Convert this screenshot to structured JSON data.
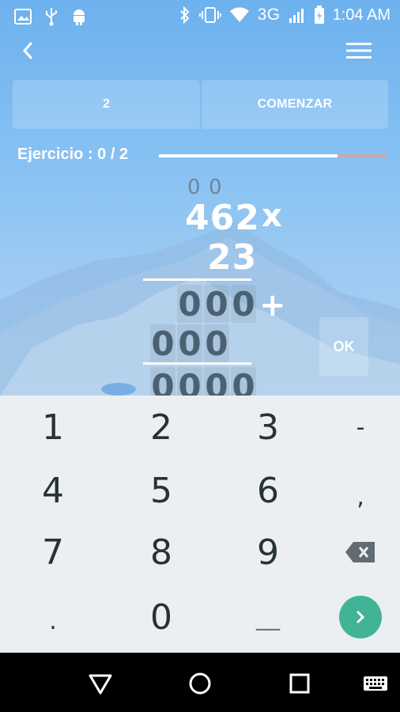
{
  "status_bar": {
    "network": "3G",
    "time": "1:04 AM",
    "icons": [
      "image-icon",
      "usb-icon",
      "android-icon",
      "bluetooth-icon",
      "vibrate-icon",
      "wifi-icon",
      "signal-icon",
      "battery-icon"
    ]
  },
  "toolbar": {
    "back_icon": "chevron-left-icon",
    "menu_icon": "hamburger-menu-icon"
  },
  "controls": {
    "count": "2",
    "start_label": "COMENZAR"
  },
  "exercise": {
    "label": "Ejercicio : 0 / 2",
    "progress": 0.78
  },
  "problem": {
    "carry": [
      "0",
      "0"
    ],
    "multiplicand": "462",
    "multiplier": "23",
    "times_sign": "x",
    "plus_sign": "+",
    "partial1": [
      "0",
      "0",
      "0"
    ],
    "partial2": [
      "0",
      "0",
      "0"
    ],
    "result": [
      "0",
      "0",
      "0",
      "0"
    ],
    "ok_label": "OK"
  },
  "keyboard": {
    "keys": [
      "1",
      "2",
      "3",
      "-",
      "4",
      "5",
      "6",
      ",",
      "7",
      "8",
      "9",
      ".",
      "0",
      "__"
    ],
    "backspace_icon": "backspace-icon",
    "enter_icon": "chevron-right-icon",
    "enter_color": "#41b497"
  },
  "navbar": {
    "icons": [
      "back-triangle-icon",
      "home-circle-icon",
      "recents-square-icon",
      "keyboard-icon"
    ]
  }
}
